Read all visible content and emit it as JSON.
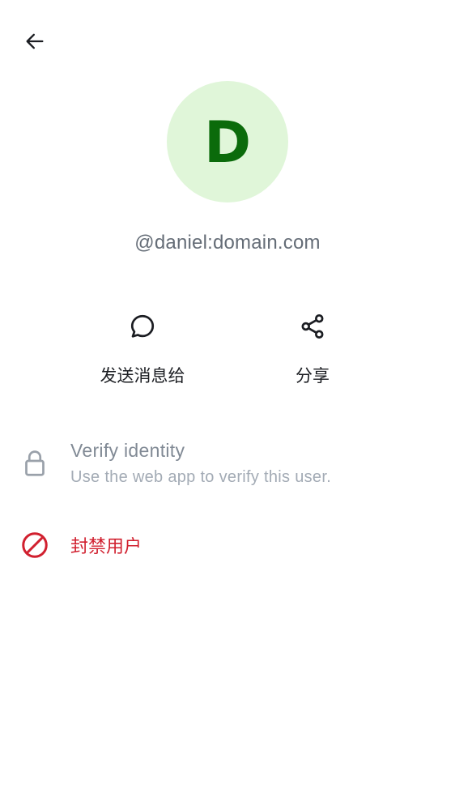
{
  "header": {
    "back_icon": "arrow-left-icon"
  },
  "profile": {
    "avatar_letter": "D",
    "avatar_bg_color": "#e0f6d9",
    "avatar_text_color": "#0b6b0b",
    "user_id": "@daniel:domain.com"
  },
  "actions": {
    "send_message": {
      "icon": "chat-bubble-icon",
      "label": "发送消息给"
    },
    "share": {
      "icon": "share-icon",
      "label": "分享"
    }
  },
  "list": {
    "verify": {
      "icon": "lock-icon",
      "title": "Verify identity",
      "subtitle": "Use the web app to verify this user."
    },
    "ban": {
      "icon": "block-icon",
      "label": "封禁用户",
      "color": "#d1202f"
    }
  }
}
